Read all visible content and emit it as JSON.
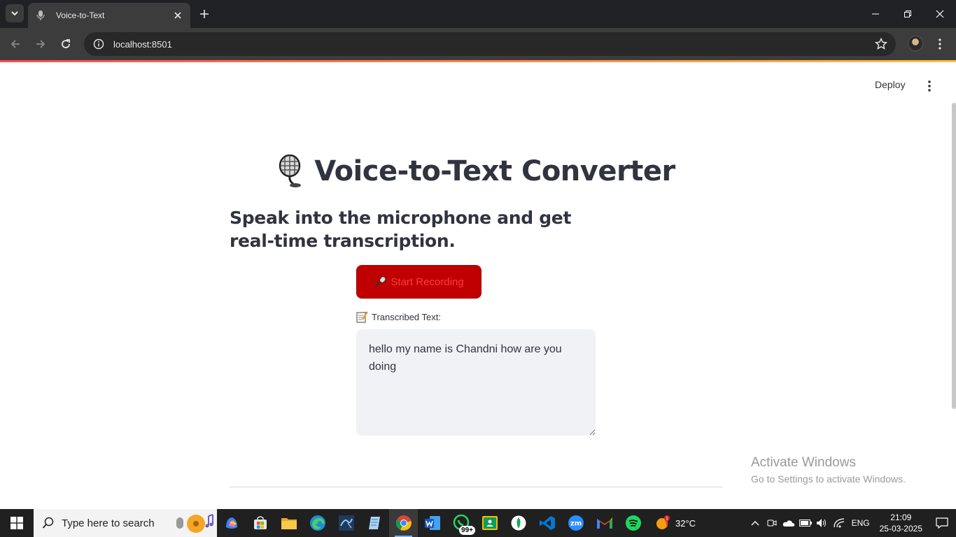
{
  "browser": {
    "tab_title": "Voice-to-Text",
    "url": "localhost:8501"
  },
  "app": {
    "deploy_label": "Deploy",
    "title": "Voice-to-Text Converter",
    "subtitle": "Speak into the microphone and get real-time transcription.",
    "record_button_label": "Start Recording",
    "transcribed_label": "Transcribed Text:",
    "transcribed_value": "hello my name is Chandni how are you doing",
    "accent_color": "#c00000"
  },
  "watermark": {
    "title": "Activate Windows",
    "subtitle": "Go to Settings to activate Windows."
  },
  "taskbar": {
    "search_placeholder": "Type here to search",
    "whatsapp_badge": "99+",
    "weather_temp": "32°C",
    "language": "ENG",
    "time": "21:09",
    "date": "25-03-2025",
    "icons": [
      "copilot-icon",
      "store-icon",
      "file-explorer-icon",
      "edge-icon",
      "mysql-workbench-icon",
      "notepad-icon",
      "chrome-icon",
      "word-icon",
      "whatsapp-icon",
      "google-classroom-icon",
      "mongodb-icon",
      "vscode-icon",
      "zoom-icon",
      "gmail-icon",
      "spotify-icon"
    ]
  }
}
